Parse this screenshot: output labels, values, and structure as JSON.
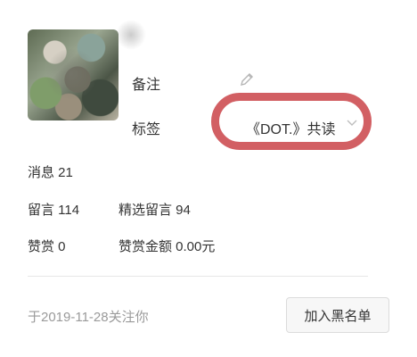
{
  "profile": {
    "remark_label": "备注",
    "tag_label": "标签",
    "tag_value": "《DOT.》共读"
  },
  "stats": {
    "messages": "消息 21",
    "comments": "留言 114",
    "selected_comments": "精选留言 94",
    "rewards": "赞赏 0",
    "reward_amount": "赞赏金额 0.00元"
  },
  "footer": {
    "follow_date": "于2019-11-28关注你",
    "block_button": "加入黑名单"
  },
  "colors": {
    "highlight_circle": "#d25f63"
  },
  "icons": {
    "edit": "pencil-icon",
    "dropdown": "chevron-down-icon"
  }
}
